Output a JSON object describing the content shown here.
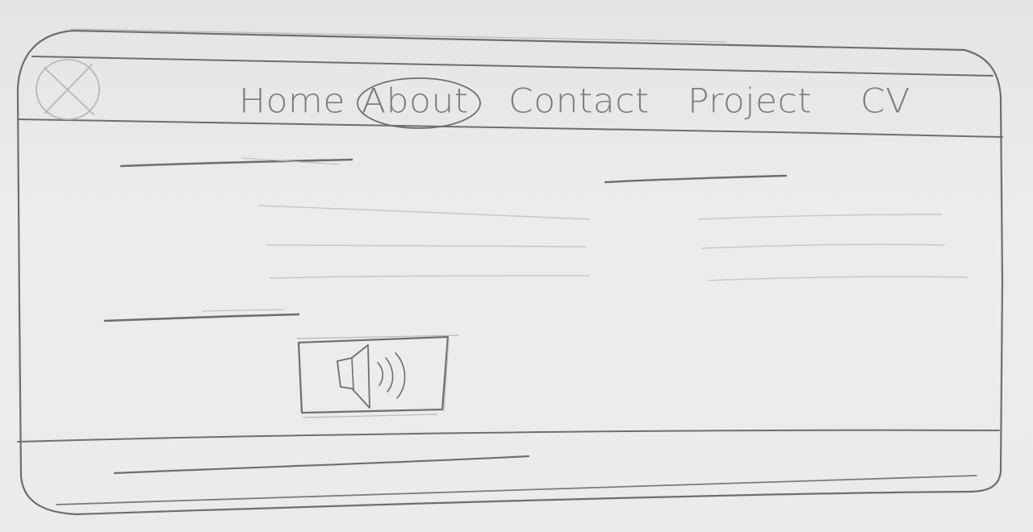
{
  "nav": {
    "items": [
      {
        "label": "Home"
      },
      {
        "label": "About",
        "active": true
      },
      {
        "label": "Contact"
      },
      {
        "label": "Project"
      },
      {
        "label": "CV"
      }
    ]
  },
  "icons": {
    "logo": "image-placeholder-icon",
    "media": "speaker-volume-icon"
  }
}
